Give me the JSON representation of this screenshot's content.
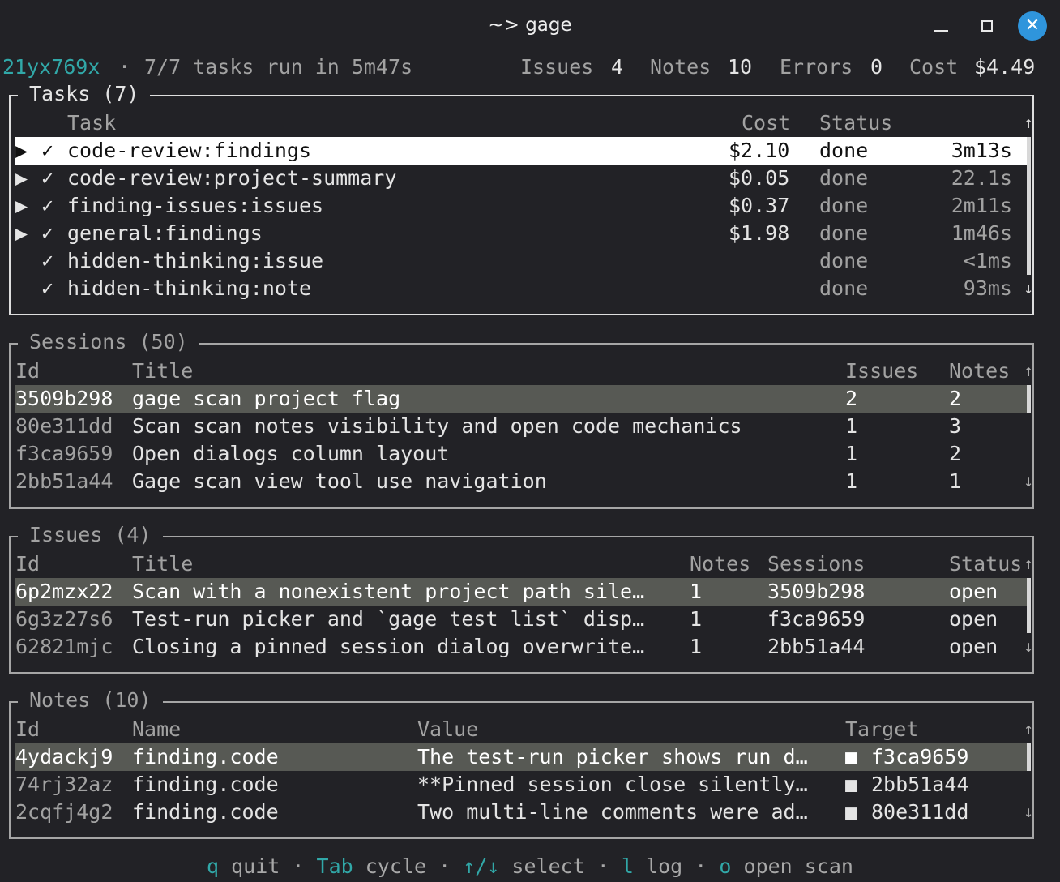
{
  "window": {
    "title": "~> gage"
  },
  "summary": {
    "run_id": "21yx769x",
    "sep": "·",
    "run_text": "7/7 tasks run in 5m47s",
    "issues_label": "Issues",
    "issues_value": "4",
    "notes_label": "Notes",
    "notes_value": "10",
    "errors_label": "Errors",
    "errors_value": "0",
    "cost_label": "Cost",
    "cost_value": "$4.49"
  },
  "tasks": {
    "title": "Tasks (7)",
    "headers": {
      "task": "Task",
      "cost": "Cost",
      "status": "Status"
    },
    "rows": [
      {
        "expand": "▶",
        "check": "✓",
        "name": "code-review:findings",
        "cost": "$2.10",
        "status": "done",
        "duration": "3m13s"
      },
      {
        "expand": "▶",
        "check": "✓",
        "name": "code-review:project-summary",
        "cost": "$0.05",
        "status": "done",
        "duration": "22.1s"
      },
      {
        "expand": "▶",
        "check": "✓",
        "name": "finding-issues:issues",
        "cost": "$0.37",
        "status": "done",
        "duration": "2m11s"
      },
      {
        "expand": "▶",
        "check": "✓",
        "name": "general:findings",
        "cost": "$1.98",
        "status": "done",
        "duration": "1m46s"
      },
      {
        "expand": "",
        "check": "✓",
        "name": "hidden-thinking:issue",
        "cost": "",
        "status": "done",
        "duration": "<1ms"
      },
      {
        "expand": "",
        "check": "✓",
        "name": "hidden-thinking:note",
        "cost": "",
        "status": "done",
        "duration": "93ms"
      }
    ]
  },
  "sessions": {
    "title": "Sessions (50)",
    "headers": {
      "id": "Id",
      "title": "Title",
      "issues": "Issues",
      "notes": "Notes"
    },
    "rows": [
      {
        "id": "3509b298",
        "title": "gage scan project flag",
        "issues": "2",
        "notes": "2"
      },
      {
        "id": "80e311dd",
        "title": "Scan scan notes visibility and open code mechanics",
        "issues": "1",
        "notes": "3"
      },
      {
        "id": "f3ca9659",
        "title": "Open dialogs column layout",
        "issues": "1",
        "notes": "2"
      },
      {
        "id": "2bb51a44",
        "title": "Gage scan view tool use navigation",
        "issues": "1",
        "notes": "1"
      }
    ]
  },
  "issues": {
    "title": "Issues (4)",
    "headers": {
      "id": "Id",
      "title": "Title",
      "notes": "Notes",
      "sessions": "Sessions",
      "status": "Status"
    },
    "rows": [
      {
        "id": "6p2mzx22",
        "title": "Scan with a nonexistent project path sile…",
        "notes": "1",
        "sessions": "3509b298",
        "status": "open"
      },
      {
        "id": "6g3z27s6",
        "title": "Test-run picker and `gage test list` disp…",
        "notes": "1",
        "sessions": "f3ca9659",
        "status": "open"
      },
      {
        "id": "62821mjc",
        "title": "Closing a pinned session dialog overwrite…",
        "notes": "1",
        "sessions": "2bb51a44",
        "status": "open"
      }
    ]
  },
  "notes": {
    "title": "Notes (10)",
    "headers": {
      "id": "Id",
      "name": "Name",
      "value": "Value",
      "target": "Target"
    },
    "rows": [
      {
        "id": "4ydackj9",
        "name": "finding.code",
        "value": "The test-run picker shows run d…",
        "target_mark": "■",
        "target": "f3ca9659"
      },
      {
        "id": "74rj32az",
        "name": "finding.code",
        "value": "**Pinned session close silently…",
        "target_mark": "■",
        "target": "2bb51a44"
      },
      {
        "id": "2cqfj4g2",
        "name": "finding.code",
        "value": "Two multi-line comments were ad…",
        "target_mark": "■",
        "target": "80e311dd"
      }
    ]
  },
  "footer": {
    "keys": [
      {
        "key": "q",
        "label": "quit"
      },
      {
        "key": "Tab",
        "label": "cycle"
      },
      {
        "key": "↑/↓",
        "label": "select"
      },
      {
        "key": "l",
        "label": "log"
      },
      {
        "key": "o",
        "label": "open scan"
      }
    ],
    "sep": "·"
  },
  "scroll": {
    "up": "↑",
    "down": "↓"
  }
}
